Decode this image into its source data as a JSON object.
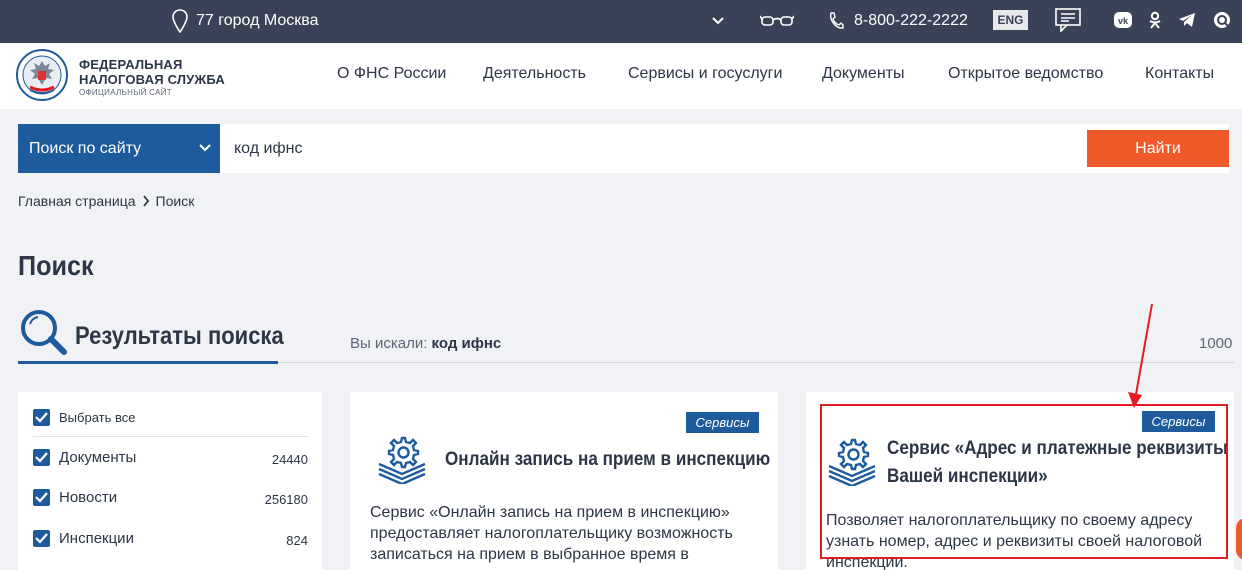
{
  "topbar": {
    "location": "77 город Москва",
    "phone": "8-800-222-2222",
    "lang": "ENG",
    "socials": [
      "vk-icon",
      "ok-icon",
      "telegram-icon",
      "chat-icon"
    ]
  },
  "header": {
    "logo": {
      "line1": "ФЕДЕРАЛЬНАЯ",
      "line2": "НАЛОГОВАЯ СЛУЖБА",
      "line3": "ОФИЦИАЛЬНЫЙ САЙТ"
    },
    "nav": [
      "О ФНС России",
      "Деятельность",
      "Сервисы и госуслуги",
      "Документы",
      "Открытое ведомство",
      "Контакты"
    ]
  },
  "search": {
    "scope": "Поиск по сайту",
    "query": "код ифнс",
    "button": "Найти"
  },
  "breadcrumb": {
    "home": "Главная страница",
    "current": "Поиск"
  },
  "page_title": "Поиск",
  "results": {
    "title": "Результаты поиска",
    "searched_label": "Вы искали:",
    "searched_query": "код ифнс",
    "total": "1000"
  },
  "filters": {
    "select_all": "Выбрать все",
    "items": [
      {
        "label": "Документы",
        "count": "24440"
      },
      {
        "label": "Новости",
        "count": "256180"
      },
      {
        "label": "Инспекции",
        "count": "824"
      }
    ]
  },
  "cards": [
    {
      "badge": "Сервисы",
      "title": "Онлайн запись на прием в инспекцию",
      "text_lines": [
        "Сервис «Онлайн запись на прием в инспекцию»",
        "предоставляет налогоплательщику возможность",
        "записаться на прием в выбранное время в"
      ]
    },
    {
      "badge": "Сервисы",
      "title_lines": [
        "Сервис «Адрес и платежные реквизиты",
        "Вашей инспекции»"
      ],
      "text_lines": [
        "Позволяет налогоплательщику по своему адресу",
        "узнать номер, адрес и реквизиты своей налоговой",
        "инспекции."
      ]
    }
  ],
  "colors": {
    "topbar": "#3a4257",
    "primary": "#1e5b9d",
    "accent": "#f0592a",
    "highlight": "#e31c23"
  }
}
